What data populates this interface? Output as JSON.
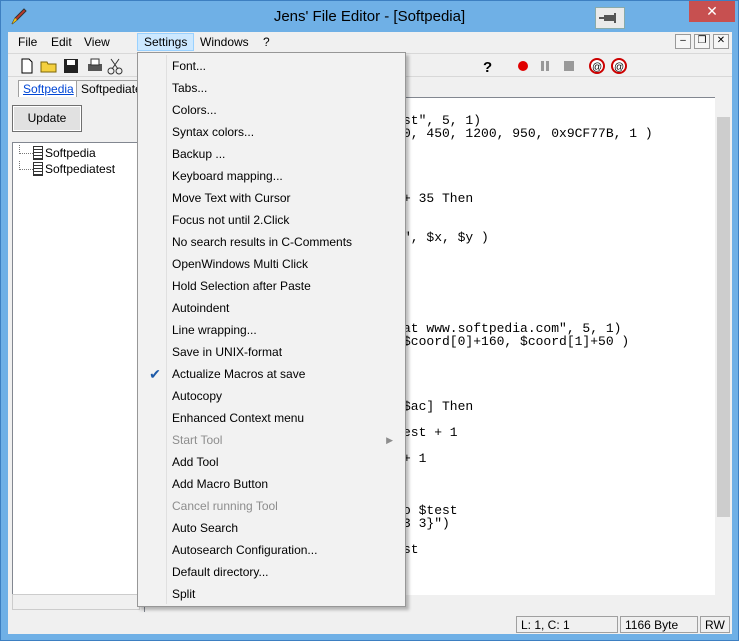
{
  "window": {
    "title": "Jens' File Editor - [Softpedia]",
    "close_label": "✕"
  },
  "menubar": {
    "items": [
      {
        "label": "File",
        "name": "menu-file"
      },
      {
        "label": "Edit",
        "name": "menu-edit"
      },
      {
        "label": "View",
        "name": "menu-view"
      },
      {
        "label": "Settings",
        "name": "menu-settings"
      },
      {
        "label": "Windows",
        "name": "menu-windows"
      },
      {
        "label": "?",
        "name": "menu-help"
      }
    ],
    "mdi_buttons": [
      "–",
      "❐",
      "✕"
    ]
  },
  "toolbar": {
    "icons": [
      "new-file-icon",
      "open-folder-icon",
      "save-icon",
      "print-icon",
      "cut-icon",
      "help-icon",
      "record-macro-icon",
      "pause-icon",
      "stop-icon",
      "play-macro-icon",
      "rewind-macro-icon"
    ]
  },
  "tabs": [
    {
      "label": "Softpedia"
    },
    {
      "label": "Softpediatest"
    }
  ],
  "sidebar": {
    "update_label": "Update",
    "tree": [
      {
        "label": "Softpedia"
      },
      {
        "label": "Softpediatest"
      }
    ]
  },
  "editor": {
    "lines": [
      {
        "text": "st\", 5, 1)",
        "row": 0
      },
      {
        "text": "0, 450, 1200, 950, 0x9CF77B, 1 )",
        "row": 1
      },
      {
        "text": "+ 35 Then",
        "row": 6
      },
      {
        "text": "\", $x, $y )",
        "row": 9
      },
      {
        "text": "at www.softpedia.com\", 5, 1)",
        "row": 16
      },
      {
        "text": "$coord[0]+160, $coord[1]+50 )",
        "row": 17
      },
      {
        "text": "$ac] Then",
        "row": 22
      },
      {
        "text": "est + 1",
        "row": 24
      },
      {
        "text": "+ 1",
        "row": 26
      },
      {
        "text": "o $test",
        "row": 30
      },
      {
        "text": "3 3}\")",
        "row": 31
      },
      {
        "text": "st",
        "row": 33
      }
    ]
  },
  "status": {
    "position": "L: 1, C: 1",
    "size": "1166 Byte",
    "mode": "RW"
  },
  "settings_menu": {
    "items": [
      {
        "label": "Font...",
        "checked": false,
        "disabled": false,
        "submenu": false
      },
      {
        "label": "Tabs...",
        "checked": false,
        "disabled": false,
        "submenu": false
      },
      {
        "label": "Colors...",
        "checked": false,
        "disabled": false,
        "submenu": false
      },
      {
        "label": "Syntax colors...",
        "checked": false,
        "disabled": false,
        "submenu": false
      },
      {
        "label": "Backup ...",
        "checked": false,
        "disabled": false,
        "submenu": false
      },
      {
        "label": "Keyboard mapping...",
        "checked": false,
        "disabled": false,
        "submenu": false
      },
      {
        "label": "Move Text with Cursor",
        "checked": false,
        "disabled": false,
        "submenu": false
      },
      {
        "label": "Focus not until 2.Click",
        "checked": false,
        "disabled": false,
        "submenu": false
      },
      {
        "label": "No search results in C-Comments",
        "checked": false,
        "disabled": false,
        "submenu": false
      },
      {
        "label": "OpenWindows Multi Click",
        "checked": false,
        "disabled": false,
        "submenu": false
      },
      {
        "label": "Hold Selection after Paste",
        "checked": false,
        "disabled": false,
        "submenu": false
      },
      {
        "label": "Autoindent",
        "checked": false,
        "disabled": false,
        "submenu": false
      },
      {
        "label": "Line wrapping...",
        "checked": false,
        "disabled": false,
        "submenu": false
      },
      {
        "label": "Save in UNIX-format",
        "checked": false,
        "disabled": false,
        "submenu": false
      },
      {
        "label": "Actualize Macros at save",
        "checked": true,
        "disabled": false,
        "submenu": false
      },
      {
        "label": "Autocopy",
        "checked": false,
        "disabled": false,
        "submenu": false
      },
      {
        "label": "Enhanced Context menu",
        "checked": false,
        "disabled": false,
        "submenu": false
      },
      {
        "label": "Start Tool",
        "checked": false,
        "disabled": true,
        "submenu": true
      },
      {
        "label": "Add Tool",
        "checked": false,
        "disabled": false,
        "submenu": false
      },
      {
        "label": "Add Macro Button",
        "checked": false,
        "disabled": false,
        "submenu": false
      },
      {
        "label": "Cancel running Tool",
        "checked": false,
        "disabled": true,
        "submenu": false
      },
      {
        "label": "Auto Search",
        "checked": false,
        "disabled": false,
        "submenu": false
      },
      {
        "label": "Autosearch Configuration...",
        "checked": false,
        "disabled": false,
        "submenu": false
      },
      {
        "label": "Default directory...",
        "checked": false,
        "disabled": false,
        "submenu": false
      },
      {
        "label": "Split",
        "checked": false,
        "disabled": false,
        "submenu": false
      }
    ]
  },
  "colors": {
    "title_bar": "#6fb0e6",
    "menu_highlight": "#cce8ff",
    "close_button": "#c75050",
    "record": "#e00000"
  }
}
